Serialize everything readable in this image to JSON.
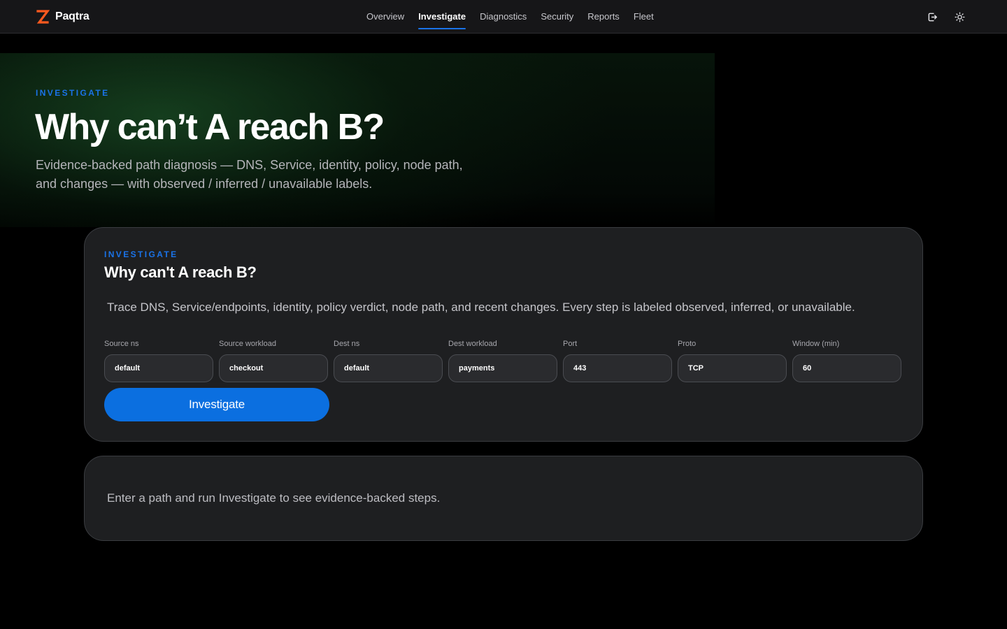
{
  "brand": {
    "name": "Paqtra",
    "logo_color": "#ff5a1f"
  },
  "nav": {
    "items": [
      {
        "label": "Overview",
        "active": false
      },
      {
        "label": "Investigate",
        "active": true
      },
      {
        "label": "Diagnostics",
        "active": false
      },
      {
        "label": "Security",
        "active": false
      },
      {
        "label": "Reports",
        "active": false
      },
      {
        "label": "Fleet",
        "active": false
      }
    ],
    "actions": [
      "logout-icon",
      "sun-icon"
    ]
  },
  "hero": {
    "eyebrow": "INVESTIGATE",
    "title": "Why can’t A reach B?",
    "subtitle": "Evidence-backed path diagnosis — DNS, Service, identity, policy, node path, and changes — with observed / inferred / unavailable labels."
  },
  "form": {
    "eyebrow": "INVESTIGATE",
    "title": "Why can't A reach B?",
    "description": "Trace DNS, Service/endpoints, identity, policy verdict, node path, and recent changes. Every step is labeled observed, inferred, or unavailable.",
    "fields": [
      {
        "label": "Source ns",
        "value": "default"
      },
      {
        "label": "Source workload",
        "value": "checkout"
      },
      {
        "label": "Dest ns",
        "value": "default"
      },
      {
        "label": "Dest workload",
        "value": "payments"
      },
      {
        "label": "Port",
        "value": "443"
      },
      {
        "label": "Proto",
        "value": "TCP"
      },
      {
        "label": "Window (min)",
        "value": "60"
      }
    ],
    "submit_label": "Investigate"
  },
  "results": {
    "empty_text": "Enter a path and run Investigate to see evidence-backed steps."
  },
  "colors": {
    "accent": "#1a73e8",
    "button": "#0b6fe0",
    "card": "#1e1f21",
    "topbar": "#161618"
  }
}
